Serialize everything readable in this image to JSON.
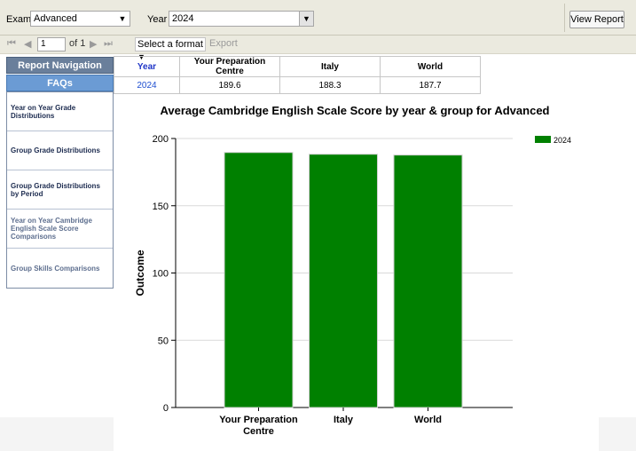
{
  "params": {
    "exam_label": "Exam",
    "exam_value": "Advanced",
    "year_label": "Year",
    "year_value": "2024",
    "view_report": "View Report"
  },
  "toolbar": {
    "page_current": "1",
    "page_of": "of 1",
    "format_placeholder": "Select a format",
    "export_label": "Export"
  },
  "navigation": {
    "title": "Report Navigation",
    "faqs": "FAQs",
    "items": [
      "Year on Year Grade Distributions",
      "Group Grade Distributions",
      "Group Grade Distributions by Period",
      "Year on Year Cambridge English Scale Score Comparisons",
      "Group Skills Comparisons"
    ]
  },
  "summary_table": {
    "headers": [
      "Year",
      "Your Preparation Centre",
      "Italy",
      "World"
    ],
    "row": [
      "2024",
      "189.6",
      "188.3",
      "187.7"
    ]
  },
  "chart_data": {
    "type": "bar",
    "title": "Average Cambridge English Scale Score by year & group for Advanced",
    "ylabel": "Outcome",
    "xlabel": "",
    "categories": [
      "Your Preparation Centre",
      "Italy",
      "World"
    ],
    "series": [
      {
        "name": "2024",
        "values": [
          189.6,
          188.3,
          187.7
        ]
      }
    ],
    "ylim": [
      0,
      200
    ],
    "yticks": [
      0,
      50,
      100,
      150,
      200
    ],
    "grid": true,
    "legend": "top-right",
    "colors": {
      "bar": "#008000",
      "gridline": "#d9d9d9"
    }
  }
}
